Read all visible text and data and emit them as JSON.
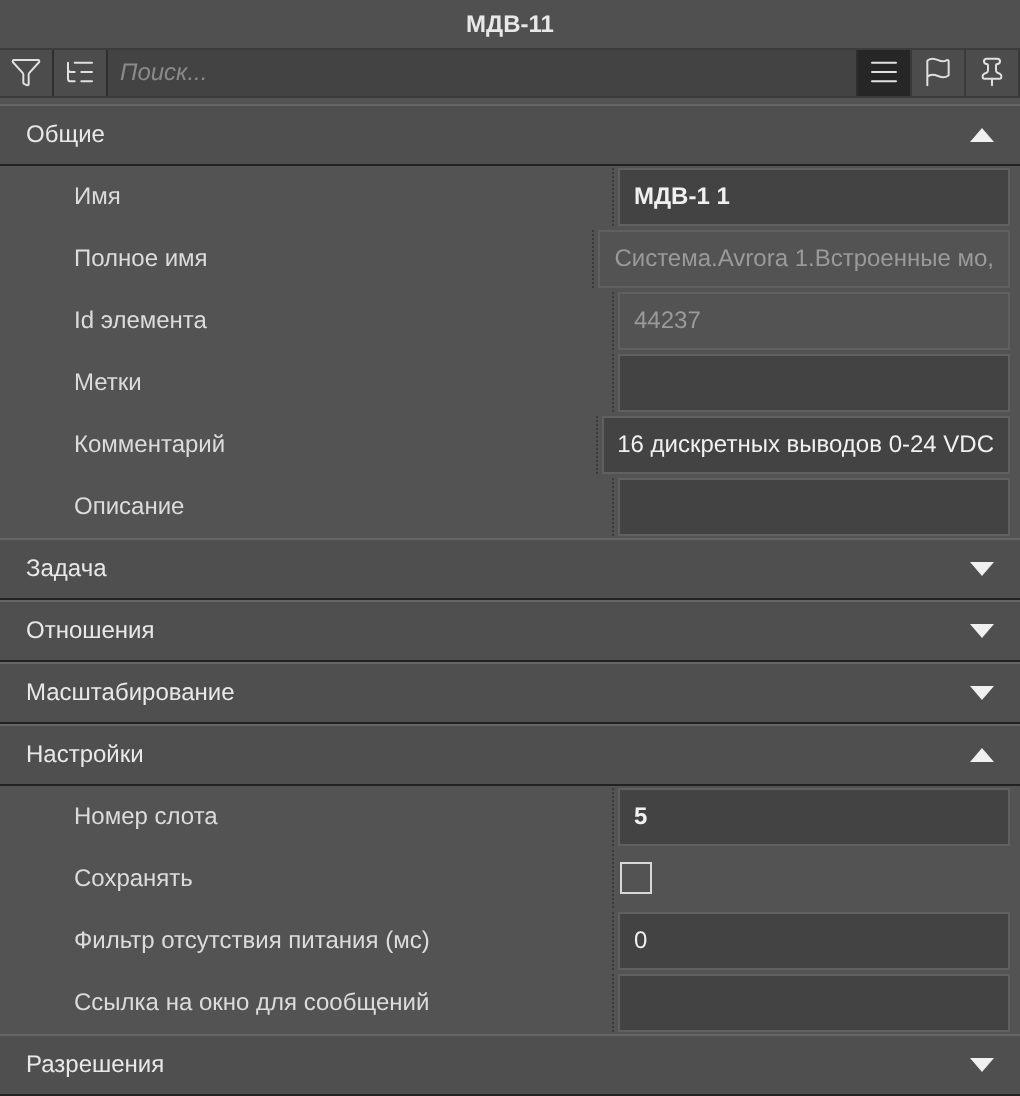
{
  "window": {
    "title": "МДВ-11"
  },
  "toolbar": {
    "search": {
      "placeholder": "Поиск..."
    },
    "view_buttons": [
      {
        "kind": "list",
        "selected": true
      },
      {
        "kind": "flag",
        "selected": false
      },
      {
        "kind": "pin",
        "selected": false
      }
    ]
  },
  "sections": [
    {
      "title": "Общие",
      "expanded": true,
      "rows": [
        {
          "kind": "text",
          "label": "Имя",
          "value": "МДВ-1 1",
          "bold": true,
          "readonly": false
        },
        {
          "kind": "text",
          "label": "Полное имя",
          "value": "Система.Avrora 1.Встроенные мо,",
          "bold": false,
          "readonly": true
        },
        {
          "kind": "text",
          "label": "Id элемента",
          "value": "44237",
          "bold": false,
          "readonly": true
        },
        {
          "kind": "text",
          "label": "Метки",
          "bold": false,
          "readonly": false
        },
        {
          "kind": "text",
          "label": "Комментарий",
          "value": "16 дискретных выводов 0-24 VDC",
          "bold": false,
          "readonly": false
        },
        {
          "kind": "text",
          "label": "Описание",
          "bold": false,
          "readonly": false
        }
      ]
    },
    {
      "title": "Задача",
      "expanded": false
    },
    {
      "title": "Отношения",
      "expanded": false
    },
    {
      "title": "Масштабирование",
      "expanded": false
    },
    {
      "title": "Настройки",
      "expanded": true,
      "rows": [
        {
          "kind": "text",
          "label": "Номер слота",
          "value": "5",
          "bold": true,
          "readonly": false
        },
        {
          "kind": "checkbox",
          "label": "Сохранять",
          "checked": false
        },
        {
          "kind": "text",
          "label": "Фильтр отсутствия питания (мс)",
          "value": "0",
          "bold": false,
          "readonly": false
        },
        {
          "kind": "text",
          "label": "Ссылка на окно для сообщений",
          "bold": false,
          "readonly": false
        }
      ]
    },
    {
      "title": "Разрешения",
      "expanded": false
    }
  ]
}
